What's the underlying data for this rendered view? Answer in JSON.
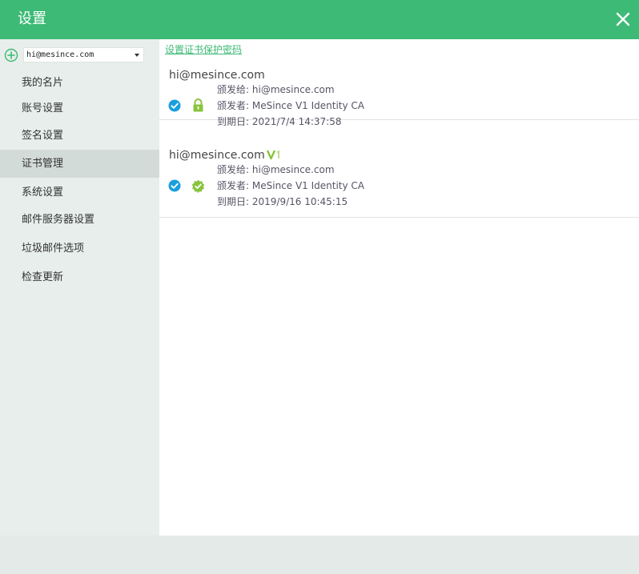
{
  "window": {
    "title": "设置"
  },
  "sidebar": {
    "account": {
      "value": "hi@mesince.com"
    },
    "items": [
      {
        "label": "我的名片"
      },
      {
        "label": "账号设置"
      },
      {
        "label": "签名设置"
      },
      {
        "label": "证书管理",
        "active": true
      },
      {
        "label": "系统设置"
      },
      {
        "label": "邮件服务器设置"
      },
      {
        "label": "垃圾邮件选项"
      },
      {
        "label": "检查更新"
      }
    ]
  },
  "main": {
    "password_link": "设置证书保护密码",
    "certificates": [
      {
        "email": "hi@mesince.com",
        "issued_to_label": "颁发给:",
        "issued_to": "hi@mesince.com",
        "issuer_label": "颁发者:",
        "issuer": "MeSince V1 Identity CA",
        "expiry_label": "到期日:",
        "expiry": "2021/7/4 14:37:58",
        "status_icon": "lock-icon",
        "checked": true
      },
      {
        "email": "hi@mesince.com",
        "issued_to_label": "颁发给:",
        "issued_to": "hi@mesince.com",
        "issuer_label": "颁发者:",
        "issuer": "MeSince V1 Identity CA",
        "expiry_label": "到期日:",
        "expiry": "2019/9/16 10:45:15",
        "status_icon": "verified-badge-icon",
        "badge": "V1",
        "checked": true
      }
    ]
  },
  "colors": {
    "accent": "#3dba76",
    "check": "#1a9fdc",
    "status_green": "#8ac43f"
  }
}
